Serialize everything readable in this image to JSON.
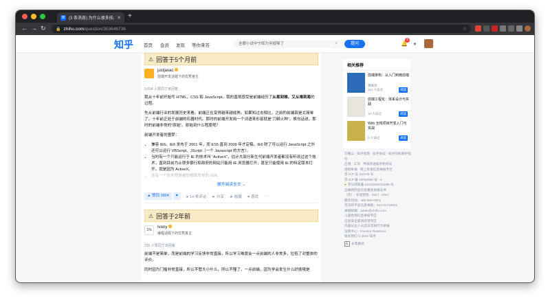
{
  "browser": {
    "tab_title": "(3 条消息) 为什么很多技术都想",
    "tab_favicon": "知",
    "url_domain": "zhihu.com",
    "url_path": "/question/353646736",
    "colors": {
      "close": "#ff5f57",
      "min": "#febc2e",
      "max": "#28c840"
    }
  },
  "header": {
    "logo": "知乎",
    "nav": [
      "首页",
      "会员",
      "发现",
      "等你来答"
    ],
    "search_placeholder": "全娜小说中宁辉为何投降了",
    "ask_label": "提问",
    "notification_count": "3"
  },
  "answer1": {
    "banner": "回答于5个月前",
    "author_name": "justjavac",
    "author_desc": "前端开发话题下的优秀答主",
    "agree_count": "3,604 人赞同了该回答",
    "p1_pre": "我从十年前开始写 HTML、CSS 和 JavaScript。我的直观感受是前端经历了",
    "p1_bold": "从易到难，又从难到易",
    "p1_post": "的过程。",
    "p2": "先从前端行业的发展历史来看。前端正在变得越来越成熟。如果知过去相比，之前的前端真是太简单了。十年前正处于前端的石器时代。那时的前端开发用一个词语来形容就是“刀耕火种”。换句话说，那时的前端非常的“原始”。原始到什么程度呢？",
    "p3": "前端开发者的噩梦：",
    "list": [
      "兼容 IE6。IE6 发布于 2001 年，而 ES5 直到 2009 年才定稿，IE6 除了可以运行 JavaScript 之外还可以运行 VBScript、JScript（一个 Javascript 的方言）。",
      "当时有一个只能运行于 IE 的技术叫 “ActiveX”，估计大部分新生代前端开发者都没有听说过这个技术，直到目前为止很多银行和政府的网站只能用 IE 浏览器打开，甚至只能使用 IE 的特定版本打开。就是因为 ActiveX。"
    ],
    "list_fade": "还有一个技术就是被的微软发布的 XML",
    "expand_label": "展开阅读全文",
    "vote_label": "赞同 3804",
    "comments": "14 条评论",
    "share": "分享",
    "favorite": "收藏",
    "like": "喜欢"
  },
  "answer2": {
    "banner": "回答于2年前",
    "author_name": "Ivony",
    "author_avatar_text": "1%",
    "author_desc": "编程话题下的优秀答主",
    "agree_count": "225 人赞同了该回答",
    "p1": "前端不是简单，而是前端的学习反馈非常直接，所以学习难度会一点前端的人非常多，拉低了对整体的评价。",
    "p2": "同时因为门槛非常直接，所以不管大小什么，所以不懂了，一点前端，因为学会发生什么好挑哦是"
  },
  "sidebar": {
    "title": "相关推荐",
    "books": [
      {
        "title": "前端架构：从入门到微前端",
        "author": "黄峰达",
        "reads": "112 人读过",
        "tag": "阅读",
        "color": "#2d6cb8"
      },
      {
        "title": "前端工程化：体系设计与实践",
        "author": "",
        "reads": "12 人读过",
        "tag": "阅读",
        "color": "#e8e5de"
      },
      {
        "title": "Web 全栈项目开发入门与实战",
        "author": "",
        "reads": "5 人读过",
        "tag": "阅读",
        "color": "#c9b24a"
      }
    ]
  },
  "footer": {
    "lines": [
      "刘看山 · 知乎指南 · 知乎协议 · 知乎隐私保护指引",
      "应用 · 工作 · 申请开通知乎机构号",
      "侵权举报 · 网上有害信息举报专区",
      "京 ICP 证 110745 号",
      "京 ICP 备 13052560 号 - 1"
    ],
    "police": "京公网安备 11010802020088 号",
    "lines2": [
      "互联网药品信息服务资格证书",
      "（京）- 非经营性 - 2017 - 0067",
      "服务热线：400-919-0001",
      "违法和不良信息举报：010-82716601",
      "举报邮箱：jubao@zhihu.com",
      "儿童色情信息举报专区",
      "信息安全漏洞反馈专区",
      "内容从业人员违法违规行为举报",
      "证照中心 · Investor Relations",
      "联系我们 © 2022 知乎"
    ],
    "old_mode": "长辈模式"
  }
}
